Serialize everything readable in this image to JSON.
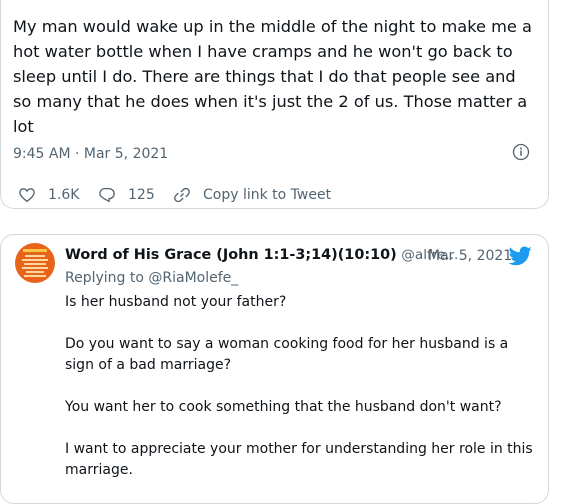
{
  "main_tweet": {
    "text": "My man would wake up in the middle of the night to make me a hot water bottle when I have cramps and he won't go back to sleep until I do. There are things that I do that people see and so many that he does when it's just the 2 of us. Those matter a lot",
    "timestamp": "9:45 AM · Mar 5, 2021",
    "likes": "1.6K",
    "replies": "125",
    "copy_link_label": "Copy link to Tweet"
  },
  "reply_tweet": {
    "display_name": "Word of His Grace (John 1:1-3;14)(10:10)",
    "handle": "@alfre...",
    "date": "· Mar 5, 2021",
    "replying_to_prefix": "Replying to ",
    "replying_to_handle": "@RiaMolefe_",
    "paragraphs": [
      "Is her husband not your father?",
      "Do you want to say a woman cooking food for her husband is a sign of a bad marriage?",
      "You want her to cook something that the husband don't want?",
      "I want to appreciate your mother for understanding her role in this marriage."
    ]
  },
  "colors": {
    "text_primary": "#0f1419",
    "text_secondary": "#536471",
    "twitter_blue": "#1d9bf0",
    "border": "#cfd9de",
    "avatar_orange": "#e8641b"
  },
  "icons": [
    "info-icon",
    "heart-icon",
    "reply-icon",
    "link-icon",
    "twitter-bird-icon"
  ]
}
